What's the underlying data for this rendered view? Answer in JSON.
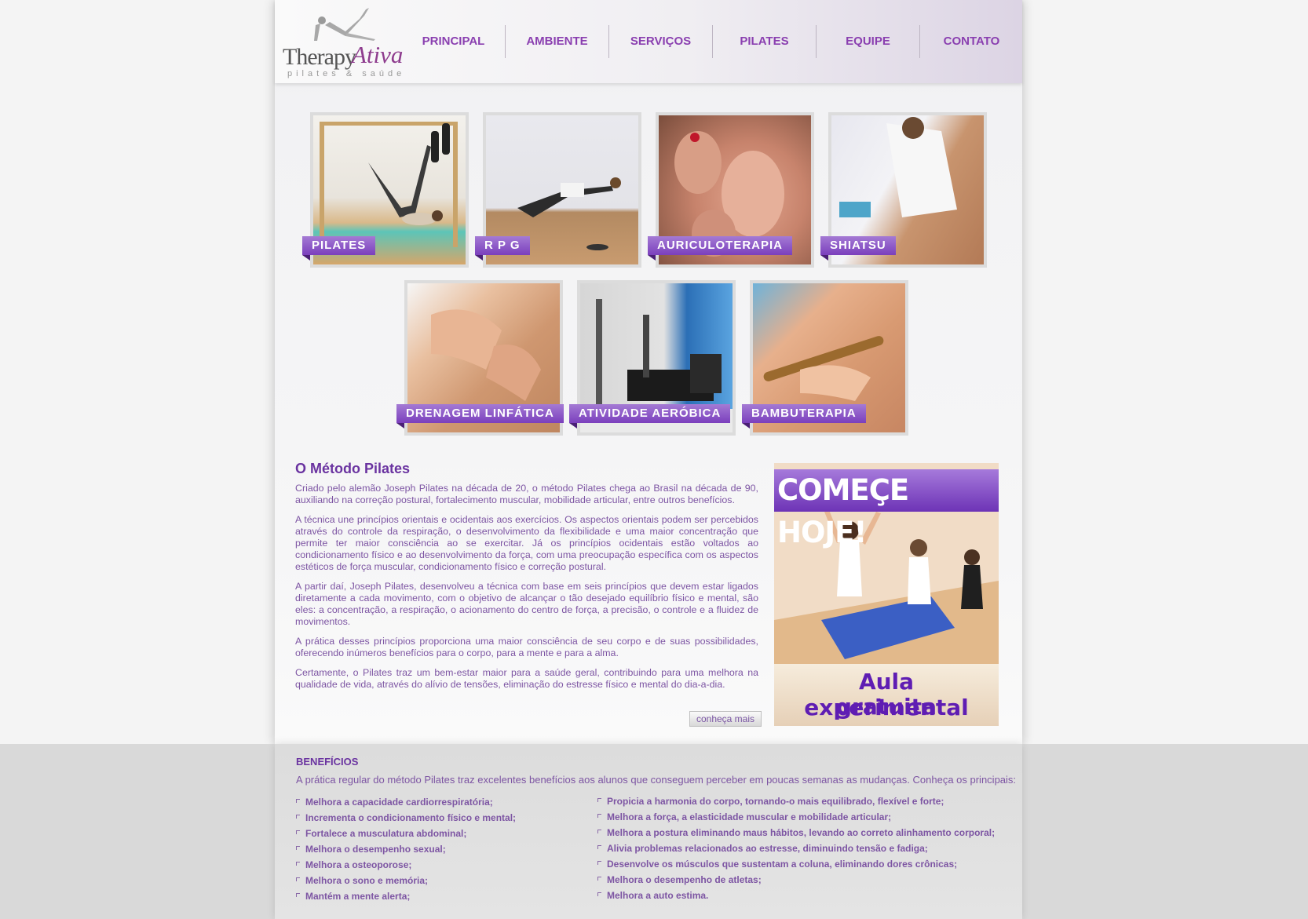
{
  "brand": {
    "name_part1": "Therapy",
    "name_part2": "Ativa",
    "tagline": "pilates & saúde"
  },
  "nav": [
    "PRINCIPAL",
    "AMBIENTE",
    "SERVIÇOS",
    "PILATES",
    "EQUIPE",
    "CONTATO"
  ],
  "services": [
    "PILATES",
    "R P G",
    "AURICULOTERAPIA",
    "SHIATSU",
    "DRENAGEM LINFÁTICA",
    "ATIVIDADE AERÓBICA",
    "BAMBUTERAPIA"
  ],
  "article": {
    "title": "O Método Pilates",
    "paragraphs": [
      "Criado pelo alemão Joseph Pilates na década de 20, o método Pilates chega ao Brasil na década de 90, auxiliando na correção postural, fortalecimento muscular, mobilidade articular, entre outros benefícios.",
      "A técnica une princípios orientais e ocidentais  aos exercícios. Os aspectos orientais podem ser percebidos através do controle da respiração, o desenvolvimento da flexibilidade e uma maior concentração que permite ter maior consciência ao se exercitar. Já os princípios ocidentais estão voltados ao condicionamento físico e ao desenvolvimento da força, com uma preocupação específica com os aspectos estéticos de força muscular, condicionamento físico e correção postural.",
      "A partir daí, Joseph Pilates, desenvolveu a técnica com base em seis princípios que devem estar ligados diretamente a cada movimento, com o objetivo de alcançar o tão desejado equilíbrio físico e mental, são eles: a concentração, a respiração, o acionamento do centro de força, a precisão, o controle e a fluidez de movimentos.",
      "A prática desses princípios proporciona uma maior consciência de seu corpo e de suas possibilidades, oferecendo inúmeros benefícios para o corpo, para a mente e para a alma.",
      "Certamente, o Pilates traz um bem-estar maior para a saúde geral, contribuindo para uma melhora na qualidade de vida, através do alívio de tensões, eliminação do estresse físico e mental do dia-a-dia."
    ],
    "more_label": "conheça mais"
  },
  "promo": {
    "headline": "COMEÇE HOJE!",
    "line1": "Aula experimental",
    "line2": "gratuita"
  },
  "benefits": {
    "title": "BENEFÍCIOS",
    "intro": "A prática regular do método Pilates traz excelentes benefícios aos alunos que conseguem perceber em poucas semanas as mudanças. Conheça os principais:",
    "left": [
      "Melhora a capacidade cardiorrespiratória;",
      "Incrementa o condicionamento físico e mental;",
      "Fortalece a musculatura abdominal;",
      "Melhora o desempenho sexual;",
      "Melhora a osteoporose;",
      "Melhora o sono e memória;",
      "Mantém a mente alerta;"
    ],
    "right": [
      "Propicia a harmonia do corpo, tornando-o mais equilibrado, flexível e forte;",
      "Melhora a força, a elasticidade muscular e mobilidade articular;",
      "Melhora a postura eliminando maus hábitos, levando ao correto alinhamento corporal;",
      "Alivia problemas relacionados ao estresse, diminuindo tensão e fadiga;",
      "Desenvolve os músculos que sustentam a coluna, eliminando dores crônicas;",
      "Melhora o desempenho de atletas;",
      "Melhora a auto estima."
    ]
  }
}
